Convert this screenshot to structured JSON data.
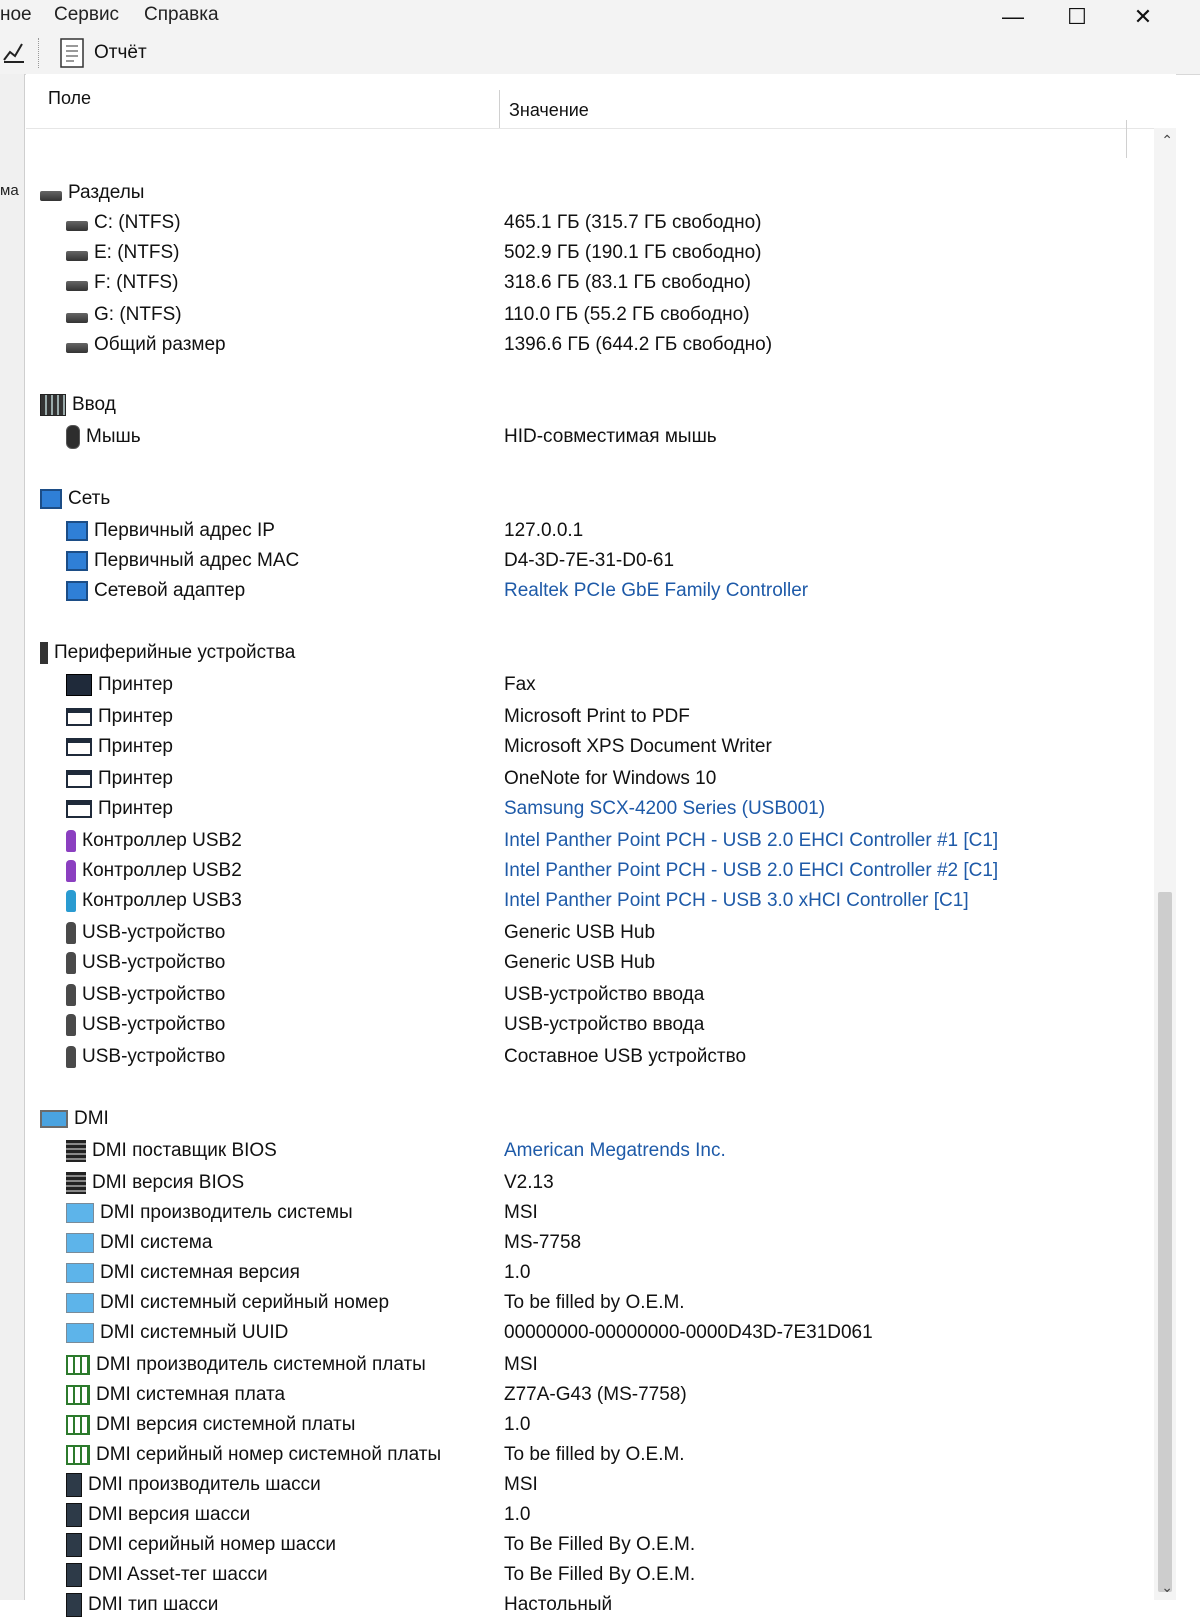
{
  "menu": {
    "items": [
      "ное",
      "Сервис",
      "Справка"
    ]
  },
  "window_controls": {
    "minimize": "—",
    "maximize": "☐",
    "close": "✕"
  },
  "toolbar": {
    "report_label": "Отчёт"
  },
  "left_pane": {
    "fragment": "ма"
  },
  "table": {
    "header": {
      "field": "Поле",
      "value": "Значение"
    },
    "rows": [
      {
        "level": 0,
        "icon": "drive-icon",
        "field": "Разделы",
        "value": "",
        "link": false
      },
      {
        "level": 1,
        "icon": "drive-icon",
        "field": "C: (NTFS)",
        "value": "465.1 ГБ (315.7 ГБ свободно)",
        "link": false
      },
      {
        "level": 1,
        "icon": "drive-icon",
        "field": "E: (NTFS)",
        "value": "502.9 ГБ (190.1 ГБ свободно)",
        "link": false
      },
      {
        "level": 1,
        "icon": "drive-icon",
        "field": "F: (NTFS)",
        "value": "318.6 ГБ (83.1 ГБ свободно)",
        "link": false
      },
      {
        "level": 1,
        "icon": "drive-icon",
        "field": "G: (NTFS)",
        "value": "110.0 ГБ (55.2 ГБ свободно)",
        "link": false
      },
      {
        "level": 1,
        "icon": "drive-icon",
        "field": "Общий размер",
        "value": "1396.6 ГБ (644.2 ГБ свободно)",
        "link": false
      },
      {
        "level": 0,
        "icon": "input-icon",
        "field": "Ввод",
        "value": "",
        "link": false
      },
      {
        "level": 1,
        "icon": "mouse-icon",
        "field": "Мышь",
        "value": "HID-совместимая мышь",
        "link": false
      },
      {
        "level": 0,
        "icon": "network-icon",
        "field": "Сеть",
        "value": "",
        "link": false
      },
      {
        "level": 1,
        "icon": "network-icon",
        "field": "Первичный адрес IP",
        "value": "127.0.0.1",
        "link": false
      },
      {
        "level": 1,
        "icon": "network-icon",
        "field": "Первичный адрес MAC",
        "value": "D4-3D-7E-31-D0-61",
        "link": false
      },
      {
        "level": 1,
        "icon": "network-icon",
        "field": "Сетевой адаптер",
        "value": "Realtek PCIe GbE Family Controller",
        "link": true
      },
      {
        "level": 0,
        "icon": "peripheral-icon",
        "field": "Периферийные устройства",
        "value": "",
        "link": false
      },
      {
        "level": 1,
        "icon": "fax-printer-icon",
        "field": "Принтер",
        "value": "Fax",
        "link": false
      },
      {
        "level": 1,
        "icon": "printer-icon",
        "field": "Принтер",
        "value": "Microsoft Print to PDF",
        "link": false
      },
      {
        "level": 1,
        "icon": "printer-icon",
        "field": "Принтер",
        "value": "Microsoft XPS Document Writer",
        "link": false
      },
      {
        "level": 1,
        "icon": "printer-icon",
        "field": "Принтер",
        "value": "OneNote for Windows 10",
        "link": false
      },
      {
        "level": 1,
        "icon": "printer-icon",
        "field": "Принтер",
        "value": "Samsung SCX-4200 Series (USB001)",
        "link": true
      },
      {
        "level": 1,
        "icon": "usb-controller-icon",
        "field": "Контроллер USB2",
        "value": "Intel Panther Point PCH - USB 2.0 EHCI Controller #1 [C1]",
        "link": true
      },
      {
        "level": 1,
        "icon": "usb-controller-icon",
        "field": "Контроллер USB2",
        "value": "Intel Panther Point PCH - USB 2.0 EHCI Controller #2 [C1]",
        "link": true
      },
      {
        "level": 1,
        "icon": "usb3-controller-icon",
        "field": "Контроллер USB3",
        "value": "Intel Panther Point PCH - USB 3.0 xHCI Controller [C1]",
        "link": true
      },
      {
        "level": 1,
        "icon": "usb-device-icon",
        "field": "USB-устройство",
        "value": "Generic USB Hub",
        "link": false
      },
      {
        "level": 1,
        "icon": "usb-device-icon",
        "field": "USB-устройство",
        "value": "Generic USB Hub",
        "link": false
      },
      {
        "level": 1,
        "icon": "usb-device-icon",
        "field": "USB-устройство",
        "value": "USB-устройство ввода",
        "link": false
      },
      {
        "level": 1,
        "icon": "usb-device-icon",
        "field": "USB-устройство",
        "value": "USB-устройство ввода",
        "link": false
      },
      {
        "level": 1,
        "icon": "usb-device-icon",
        "field": "USB-устройство",
        "value": "Составное USB устройство",
        "link": false
      },
      {
        "level": 0,
        "icon": "dmi-icon",
        "field": "DMI",
        "value": "",
        "link": false
      },
      {
        "level": 1,
        "icon": "bios-icon",
        "field": "DMI поставщик BIOS",
        "value": "American Megatrends Inc.",
        "link": true
      },
      {
        "level": 1,
        "icon": "bios-icon",
        "field": "DMI версия BIOS",
        "value": "V2.13",
        "link": false
      },
      {
        "level": 1,
        "icon": "system-icon",
        "field": "DMI производитель системы",
        "value": "MSI",
        "link": false
      },
      {
        "level": 1,
        "icon": "system-icon",
        "field": "DMI система",
        "value": "MS-7758",
        "link": false
      },
      {
        "level": 1,
        "icon": "system-icon",
        "field": "DMI системная версия",
        "value": "1.0",
        "link": false
      },
      {
        "level": 1,
        "icon": "system-icon",
        "field": "DMI системный серийный номер",
        "value": "To be filled by O.E.M.",
        "link": false
      },
      {
        "level": 1,
        "icon": "system-icon",
        "field": "DMI системный UUID",
        "value": "00000000-00000000-0000D43D-7E31D061",
        "link": false
      },
      {
        "level": 1,
        "icon": "motherboard-icon",
        "field": "DMI производитель системной платы",
        "value": "MSI",
        "link": false
      },
      {
        "level": 1,
        "icon": "motherboard-icon",
        "field": "DMI системная плата",
        "value": "Z77A-G43 (MS-7758)",
        "link": false
      },
      {
        "level": 1,
        "icon": "motherboard-icon",
        "field": "DMI версия системной платы",
        "value": "1.0",
        "link": false
      },
      {
        "level": 1,
        "icon": "motherboard-icon",
        "field": "DMI серийный номер системной платы",
        "value": "To be filled by O.E.M.",
        "link": false
      },
      {
        "level": 1,
        "icon": "chassis-icon",
        "field": "DMI производитель шасси",
        "value": "MSI",
        "link": false
      },
      {
        "level": 1,
        "icon": "chassis-icon",
        "field": "DMI версия шасси",
        "value": "1.0",
        "link": false
      },
      {
        "level": 1,
        "icon": "chassis-icon",
        "field": "DMI серийный номер шасси",
        "value": "To Be Filled By O.E.M.",
        "link": false
      },
      {
        "level": 1,
        "icon": "chassis-icon",
        "field": "DMI Asset-тег шасси",
        "value": "To Be Filled By O.E.M.",
        "link": false
      },
      {
        "level": 1,
        "icon": "chassis-icon",
        "field": "DMI тип шасси",
        "value": "Настольный",
        "link": false
      }
    ]
  },
  "colors": {
    "link": "#1e5aa8",
    "text": "#111111",
    "background": "#ffffff"
  }
}
